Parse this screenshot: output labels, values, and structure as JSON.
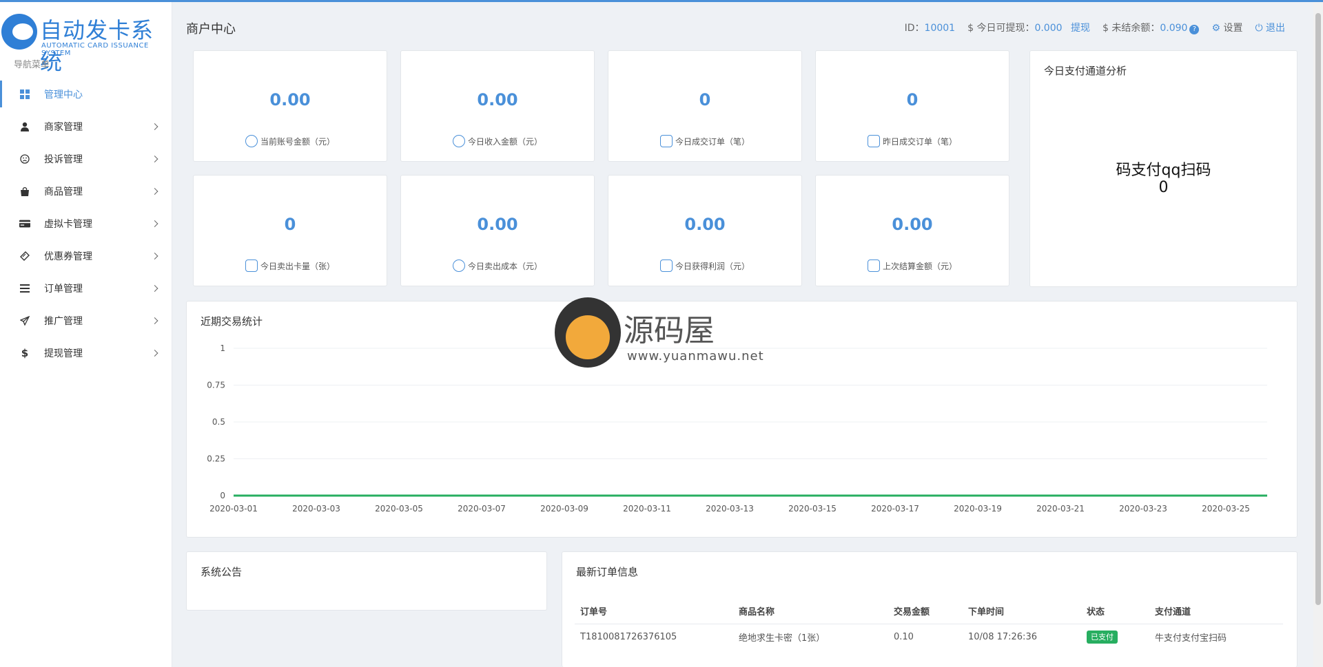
{
  "app": {
    "logo_title": "自动发卡系统",
    "logo_subtitle": "AUTOMATIC CARD ISSUANCE SYSTEM",
    "accent": "#4a90d9"
  },
  "sidebar": {
    "caption": "导航菜单",
    "items": [
      {
        "label": "管理中心",
        "icon": "dashboard-icon",
        "active": true
      },
      {
        "label": "商家管理",
        "icon": "user-icon"
      },
      {
        "label": "投诉管理",
        "icon": "sad-face-icon"
      },
      {
        "label": "商品管理",
        "icon": "shopping-bag-icon"
      },
      {
        "label": "虚拟卡管理",
        "icon": "credit-card-icon"
      },
      {
        "label": "优惠券管理",
        "icon": "ticket-icon"
      },
      {
        "label": "订单管理",
        "icon": "list-icon"
      },
      {
        "label": "推广管理",
        "icon": "paper-plane-icon"
      },
      {
        "label": "提现管理",
        "icon": "dollar-icon"
      }
    ]
  },
  "header": {
    "title": "商户中心",
    "id_label": "ID：",
    "id_value": "10001",
    "withdraw_label": "$ 今日可提现：",
    "withdraw_value": "0.000",
    "withdraw_link": "提现",
    "unsettled_label": "$ 未结余额：",
    "unsettled_value": "0.090",
    "help": "?",
    "settings": "设置",
    "logout": "退出"
  },
  "stats": [
    {
      "value": "0.00",
      "label": "当前账号金额（元）"
    },
    {
      "value": "0.00",
      "label": "今日收入金额（元）"
    },
    {
      "value": "0",
      "label": "今日成交订单（笔）"
    },
    {
      "value": "0",
      "label": "昨日成交订单（笔）"
    },
    {
      "value": "0",
      "label": "今日卖出卡量（张）"
    },
    {
      "value": "0.00",
      "label": "今日卖出成本（元）"
    },
    {
      "value": "0.00",
      "label": "今日获得利润（元）"
    },
    {
      "value": "0.00",
      "label": "上次结算金额（元）"
    }
  ],
  "channel": {
    "title": "今日支付通道分析",
    "name": "码支付qq扫码",
    "count": "0"
  },
  "trend": {
    "title": "近期交易统计"
  },
  "chart_data": {
    "type": "line",
    "title": "近期交易统计",
    "xlabel": "",
    "ylabel": "",
    "ylim": [
      0,
      1
    ],
    "yticks": [
      "0",
      "0.25",
      "0.5",
      "0.75",
      "1"
    ],
    "x": [
      "2020-03-01",
      "2020-03-02",
      "2020-03-03",
      "2020-03-04",
      "2020-03-05",
      "2020-03-06",
      "2020-03-07",
      "2020-03-08",
      "2020-03-09",
      "2020-03-10",
      "2020-03-11",
      "2020-03-12",
      "2020-03-13",
      "2020-03-14",
      "2020-03-15",
      "2020-03-16",
      "2020-03-17",
      "2020-03-18",
      "2020-03-19",
      "2020-03-20",
      "2020-03-21",
      "2020-03-22",
      "2020-03-23",
      "2020-03-24",
      "2020-03-25",
      "2020-03-26"
    ],
    "xtick_labels": [
      "2020-03-01",
      "2020-03-03",
      "2020-03-05",
      "2020-03-07",
      "2020-03-09",
      "2020-03-11",
      "2020-03-13",
      "2020-03-15",
      "2020-03-17",
      "2020-03-19",
      "2020-03-21",
      "2020-03-23",
      "2020-03-25"
    ],
    "series": [
      {
        "values": [
          0,
          0,
          0,
          0,
          0,
          0,
          0,
          0,
          0,
          0,
          0,
          0,
          0,
          0,
          0,
          0,
          0,
          0,
          0,
          0,
          0,
          0,
          0,
          0,
          0,
          0
        ],
        "color": "#27ae60"
      }
    ],
    "grid": true
  },
  "notice": {
    "title": "系统公告"
  },
  "orders": {
    "title": "最新订单信息",
    "columns": [
      "订单号",
      "商品名称",
      "交易金额",
      "下单时间",
      "状态",
      "支付通道"
    ],
    "rows": [
      {
        "id": "T1810081726376105",
        "product": "绝地求生卡密（1张）",
        "amount": "0.10",
        "time": "10/08 17:26:36",
        "status": "已支付",
        "channel": "牛支付支付宝扫码"
      }
    ]
  },
  "watermark": {
    "text": "源码屋",
    "url": "www.yuanmawu.net"
  }
}
